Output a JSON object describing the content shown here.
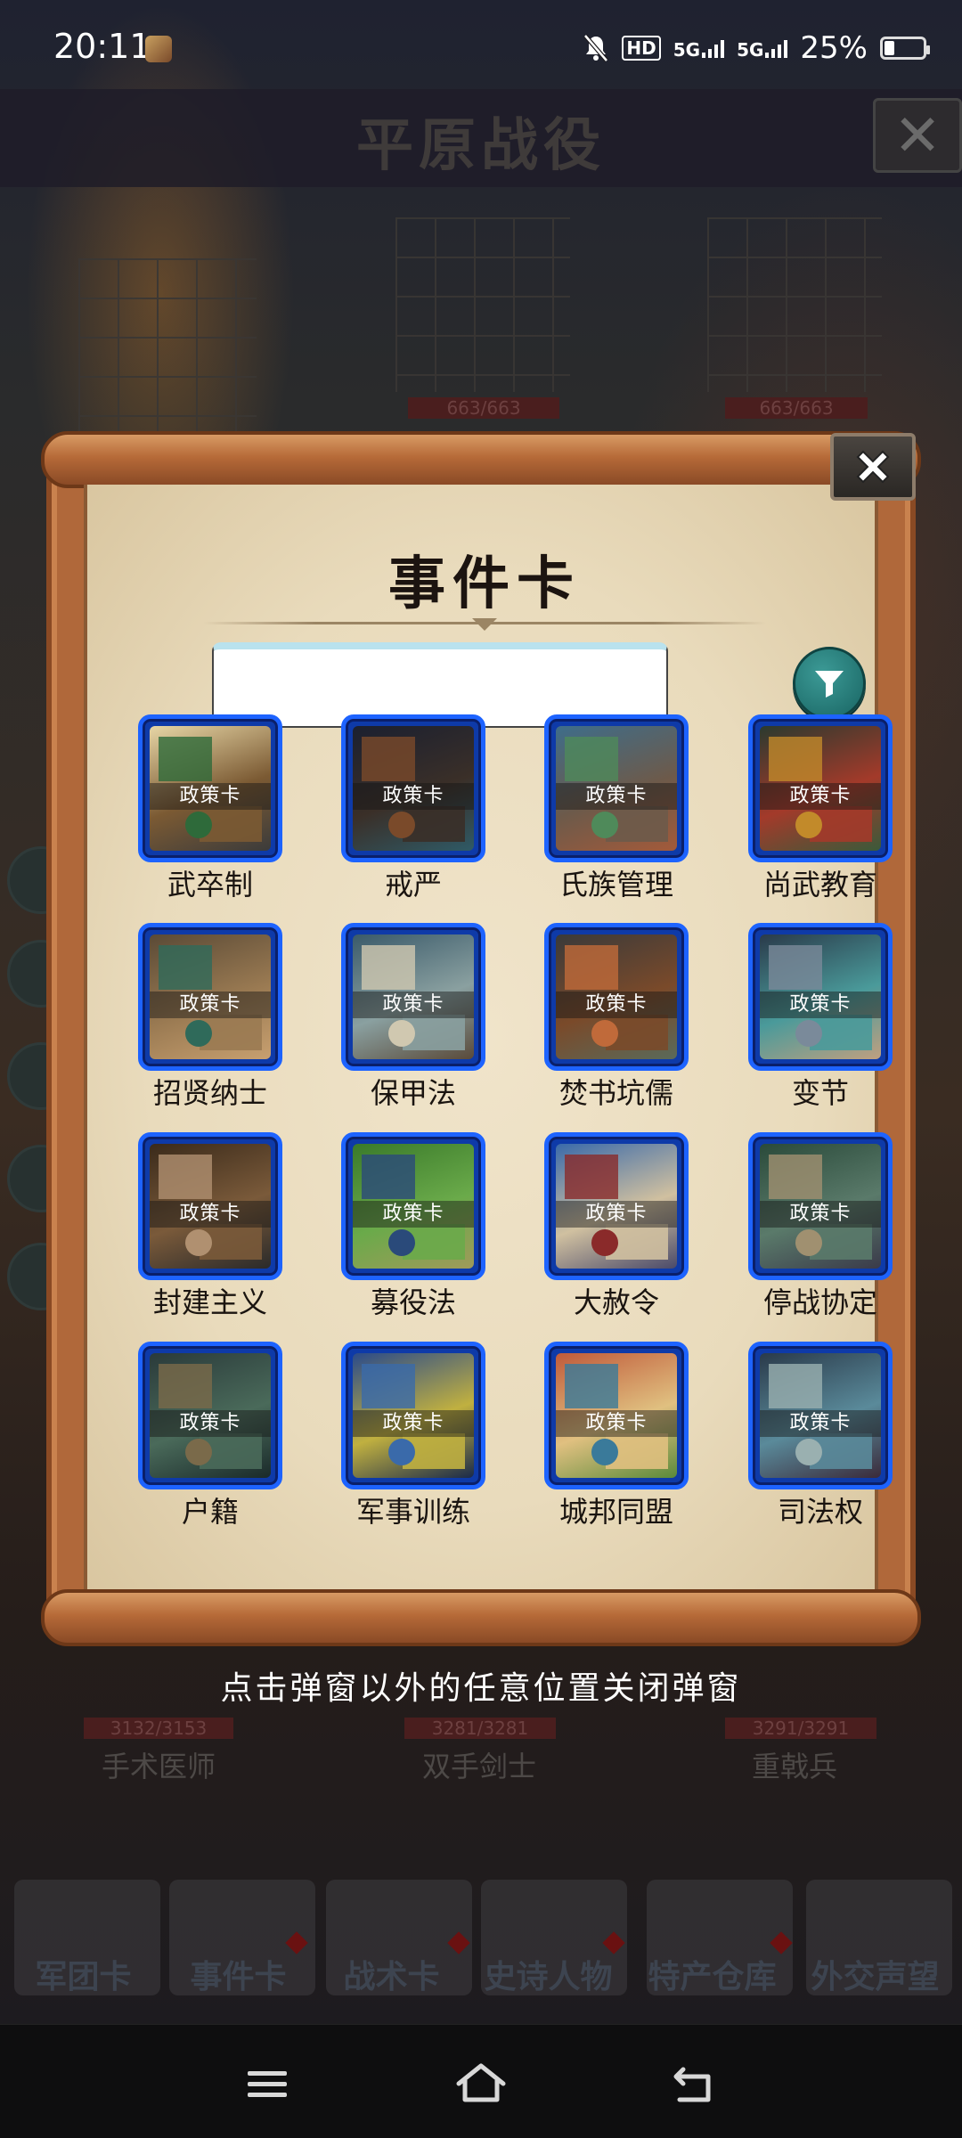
{
  "status_bar": {
    "time": "20:11",
    "hd_label": "HD",
    "net1": "5G",
    "net2": "5G",
    "battery_percent": "25%",
    "battery_level": 0.25,
    "icons": [
      "game-app-icon",
      "bell-muted-icon",
      "hd-voice-icon",
      "signal-icon",
      "signal-icon",
      "battery-icon"
    ]
  },
  "background": {
    "title": "平原战役",
    "hp_top": [
      "663/663",
      "663/663"
    ],
    "unit_names_bottom": [
      "手术医师",
      "双手剑士",
      "重戟兵"
    ],
    "hp_bottom": [
      "3132/3153",
      "3281/3281",
      "3291/3291"
    ],
    "bottom_tabs": [
      "军团卡",
      "事件卡",
      "战术卡",
      "史诗人物",
      "特产仓库",
      "外交声望"
    ]
  },
  "modal": {
    "title": "事件卡",
    "search": {
      "value": "",
      "placeholder": ""
    },
    "card_tag": "政策卡",
    "cards": [
      {
        "label": "武卒制"
      },
      {
        "label": "戒严"
      },
      {
        "label": "氏族管理"
      },
      {
        "label": "尚武教育"
      },
      {
        "label": "招贤纳士"
      },
      {
        "label": "保甲法"
      },
      {
        "label": "焚书坑儒"
      },
      {
        "label": "变节"
      },
      {
        "label": "封建主义"
      },
      {
        "label": "募役法"
      },
      {
        "label": "大赦令"
      },
      {
        "label": "停战协定"
      },
      {
        "label": "户籍"
      },
      {
        "label": "军事训练"
      },
      {
        "label": "城邦同盟"
      },
      {
        "label": "司法权"
      }
    ]
  },
  "hint": "点击弹窗以外的任意位置关闭弹窗",
  "nav": {
    "icons": [
      "menu-icon",
      "home-icon",
      "back-icon"
    ]
  },
  "colors": {
    "card_border": "#1d63ff",
    "filter_button": "#1f7a77",
    "scroll_wood": "#b0683a",
    "parchment": "#ece0c4"
  }
}
